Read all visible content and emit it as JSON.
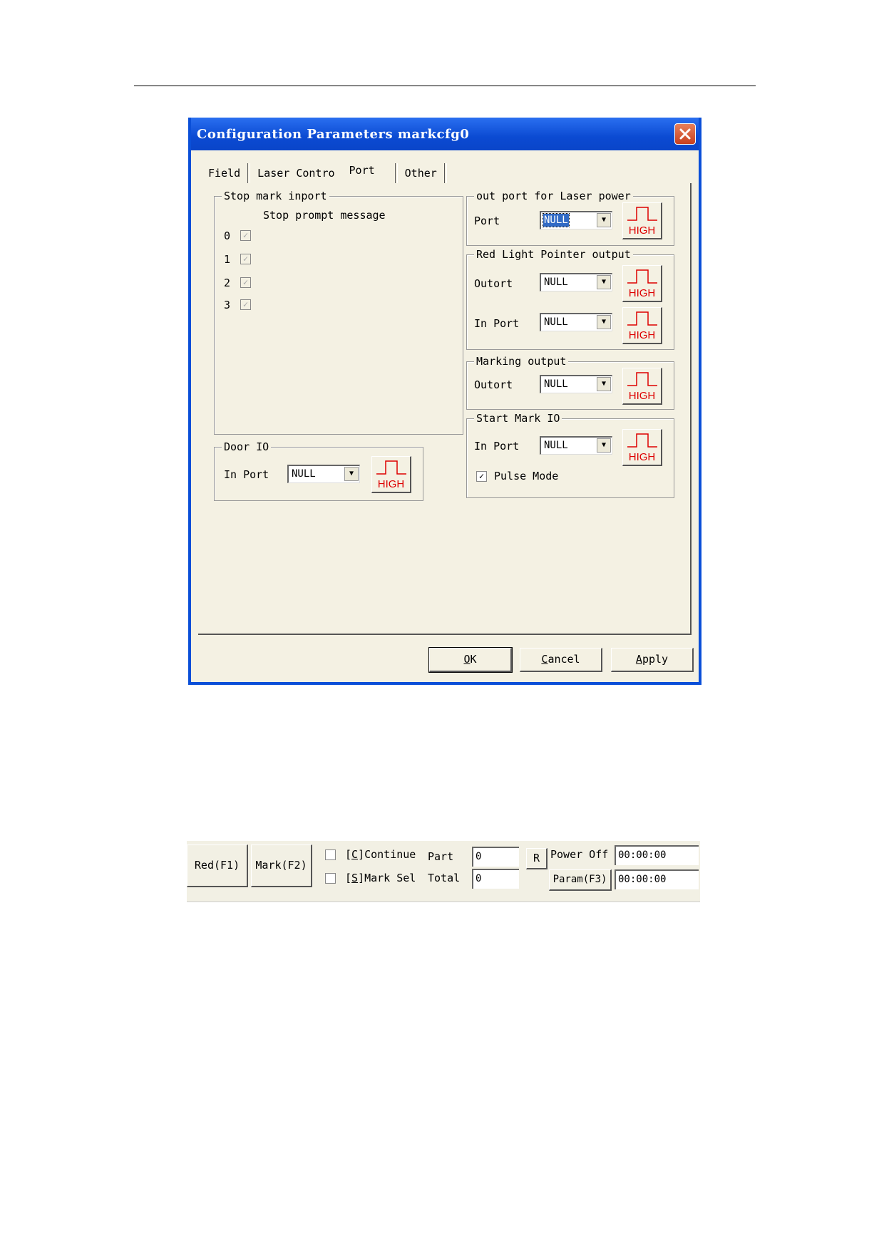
{
  "dialog": {
    "title": "Configuration Parameters markcfg0",
    "tabs": [
      "Field",
      "Laser Contro",
      "Port",
      "Other"
    ],
    "active_tab": "Port",
    "stop_mark": {
      "group_title": "Stop mark inport",
      "column_header": "Stop prompt message",
      "rows": [
        {
          "index": "0",
          "checked": true
        },
        {
          "index": "1",
          "checked": true
        },
        {
          "index": "2",
          "checked": true
        },
        {
          "index": "3",
          "checked": true
        }
      ]
    },
    "door_io": {
      "group_title": "Door IO",
      "label": "In Port",
      "value": "NULL",
      "high": "HIGH"
    },
    "laser_power": {
      "group_title": "out port for Laser power",
      "label": "Port",
      "value": "NULL",
      "high": "HIGH"
    },
    "red_light": {
      "group_title": "Red Light Pointer output",
      "out_label": "Outort",
      "out_value": "NULL",
      "in_label": "In Port",
      "in_value": "NULL",
      "high": "HIGH"
    },
    "marking_output": {
      "group_title": "Marking output",
      "label": "Outort",
      "value": "NULL",
      "high": "HIGH"
    },
    "start_mark": {
      "group_title": "Start Mark IO",
      "label": "In Port",
      "value": "NULL",
      "high": "HIGH",
      "pulse_label": "Pulse Mode",
      "pulse_checked": true
    },
    "buttons": {
      "ok_u": "O",
      "ok_rest": "K",
      "cancel_u": "C",
      "cancel_rest": "ancel",
      "apply_u": "A",
      "apply_rest": "pply"
    }
  },
  "toolbar": {
    "red_btn": "Red(F1)",
    "mark_btn": "Mark(F2)",
    "continue_pre": "[",
    "continue_u": "C",
    "continue_post": "]Continue",
    "marksel_pre": "[",
    "marksel_u": "S",
    "marksel_post": "]Mark Sel",
    "part_label": "Part",
    "part_value": "0",
    "total_label": "Total",
    "total_value": "0",
    "r_btn": "R",
    "power_off": "Power Off",
    "param_btn": "Param(F3)",
    "time1": "00:00:00",
    "time2": "00:00:00"
  }
}
